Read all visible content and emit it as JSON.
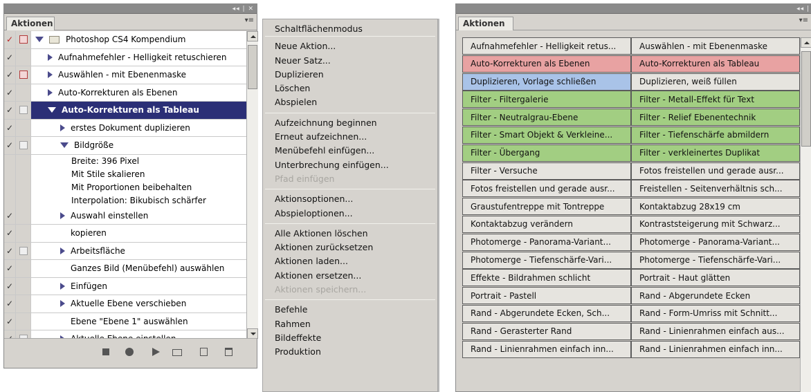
{
  "left_panel": {
    "window_controls": "◂◂ | ✕",
    "tab_label": "Aktionen",
    "menu_icon": "panel-menu-icon",
    "set": {
      "label": "Photoshop CS4 Kompendium",
      "check": "✓",
      "dialog_toggle": "red"
    },
    "actions": [
      {
        "label": "Aufnahmefehler - Helligkeit retuschieren",
        "check": "✓",
        "dialog": "none",
        "expanded": false
      },
      {
        "label": "Auswählen - mit Ebenenmaske",
        "check": "✓",
        "dialog": "red",
        "expanded": false
      },
      {
        "label": "Auto-Korrekturen als Ebenen",
        "check": "✓",
        "dialog": "none",
        "expanded": false
      },
      {
        "label": "Auto-Korrekturen als Tableau",
        "check": "✓",
        "dialog": "blank",
        "expanded": true,
        "selected": true
      }
    ],
    "steps": [
      {
        "label": "erstes Dokument duplizieren",
        "check": "✓",
        "dialog": "none",
        "expander": "right"
      },
      {
        "label": "Bildgröße",
        "check": "✓",
        "dialog": "blank",
        "expander": "down"
      }
    ],
    "step_details": [
      "Breite: 396 Pixel",
      "Mit Stile skalieren",
      "Mit Proportionen beibehalten",
      "Interpolation: Bikubisch schärfer"
    ],
    "steps_after": [
      {
        "label": "Auswahl einstellen",
        "check": "✓",
        "dialog": "none",
        "expander": "right"
      },
      {
        "label": "kopieren",
        "check": "✓",
        "dialog": "none",
        "expander": "none"
      },
      {
        "label": "Arbeitsfläche",
        "check": "✓",
        "dialog": "blank",
        "expander": "right"
      },
      {
        "label": "Ganzes Bild (Menübefehl) auswählen",
        "check": "✓",
        "dialog": "none",
        "expander": "none"
      },
      {
        "label": "Einfügen",
        "check": "✓",
        "dialog": "none",
        "expander": "right"
      },
      {
        "label": "Aktuelle Ebene verschieben",
        "check": "✓",
        "dialog": "none",
        "expander": "right"
      },
      {
        "label": "Ebene \"Ebene 1\" auswählen",
        "check": "✓",
        "dialog": "none",
        "expander": "none"
      },
      {
        "label": "Aktuelle Ebene einstellen",
        "check": "✓",
        "dialog": "blank",
        "expander": "right"
      }
    ],
    "bottom_buttons": [
      "stop-icon",
      "record-icon",
      "play-icon",
      "new-set-icon",
      "new-action-icon",
      "trash-icon"
    ]
  },
  "context_menu": {
    "groups": [
      [
        {
          "label": "Schaltflächenmodus",
          "enabled": true
        }
      ],
      [
        {
          "label": "Neue Aktion...",
          "enabled": true
        },
        {
          "label": "Neuer Satz...",
          "enabled": true
        },
        {
          "label": "Duplizieren",
          "enabled": true
        },
        {
          "label": "Löschen",
          "enabled": true
        },
        {
          "label": "Abspielen",
          "enabled": true
        }
      ],
      [
        {
          "label": "Aufzeichnung beginnen",
          "enabled": true
        },
        {
          "label": "Erneut aufzeichnen...",
          "enabled": true
        },
        {
          "label": "Menübefehl einfügen...",
          "enabled": true
        },
        {
          "label": "Unterbrechung einfügen...",
          "enabled": true
        },
        {
          "label": "Pfad einfügen",
          "enabled": false
        }
      ],
      [
        {
          "label": "Aktionsoptionen...",
          "enabled": true
        },
        {
          "label": "Abspieloptionen...",
          "enabled": true
        }
      ],
      [
        {
          "label": "Alle Aktionen löschen",
          "enabled": true
        },
        {
          "label": "Aktionen zurücksetzen",
          "enabled": true
        },
        {
          "label": "Aktionen laden...",
          "enabled": true
        },
        {
          "label": "Aktionen ersetzen...",
          "enabled": true
        },
        {
          "label": "Aktionen speichern...",
          "enabled": false
        }
      ],
      [
        {
          "label": "Befehle",
          "enabled": true
        },
        {
          "label": "Rahmen",
          "enabled": true
        },
        {
          "label": "Bildeffekte",
          "enabled": true
        },
        {
          "label": "Produktion",
          "enabled": true
        }
      ]
    ]
  },
  "right_panel": {
    "window_controls": "◂◂ |",
    "tab_label": "Aktionen",
    "colors": {
      "red": "#e8a2a2",
      "blue": "#a9c3e8",
      "green": "#a2ce82",
      "gray": "#e6e4df"
    },
    "buttons": [
      [
        {
          "label": "Aufnahmefehler - Helligkeit retus...",
          "color": "gray"
        },
        {
          "label": "Auswählen - mit Ebenenmaske",
          "color": "gray"
        }
      ],
      [
        {
          "label": "Auto-Korrekturen als Ebenen",
          "color": "red"
        },
        {
          "label": "Auto-Korrekturen als Tableau",
          "color": "red"
        }
      ],
      [
        {
          "label": "Duplizieren, Vorlage schließen",
          "color": "blue"
        },
        {
          "label": "Duplizieren, weiß füllen",
          "color": "gray"
        }
      ],
      [
        {
          "label": "Filter - Filtergalerie",
          "color": "green"
        },
        {
          "label": "Filter - Metall-Effekt für Text",
          "color": "green"
        }
      ],
      [
        {
          "label": "Filter - Neutralgrau-Ebene",
          "color": "green"
        },
        {
          "label": "Filter - Relief Ebenentechnik",
          "color": "green"
        }
      ],
      [
        {
          "label": "Filter - Smart Objekt & Verkleine...",
          "color": "green"
        },
        {
          "label": "Filter - Tiefenschärfe abmildern",
          "color": "green"
        }
      ],
      [
        {
          "label": "Filter - Übergang",
          "color": "green"
        },
        {
          "label": "Filter - verkleinertes Duplikat",
          "color": "green"
        }
      ],
      [
        {
          "label": "Filter - Versuche",
          "color": "gray"
        },
        {
          "label": "Fotos freistellen und gerade ausr...",
          "color": "gray"
        }
      ],
      [
        {
          "label": "Fotos freistellen und gerade ausr...",
          "color": "gray"
        },
        {
          "label": "Freistellen - Seitenverhältnis sch...",
          "color": "gray"
        }
      ],
      [
        {
          "label": "Graustufentreppe mit Tontreppe",
          "color": "gray"
        },
        {
          "label": "Kontaktabzug 28x19 cm",
          "color": "gray"
        }
      ],
      [
        {
          "label": "Kontaktabzug verändern",
          "color": "gray"
        },
        {
          "label": "Kontraststeigerung mit Schwarz...",
          "color": "gray"
        }
      ],
      [
        {
          "label": "Photomerge - Panorama-Variant...",
          "color": "gray"
        },
        {
          "label": "Photomerge - Panorama-Variant...",
          "color": "gray"
        }
      ],
      [
        {
          "label": "Photomerge - Tiefenschärfe-Vari...",
          "color": "gray"
        },
        {
          "label": "Photomerge - Tiefenschärfe-Vari...",
          "color": "gray"
        }
      ],
      [
        {
          "label": "Effekte - Bildrahmen schlicht",
          "color": "gray"
        },
        {
          "label": "Portrait - Haut glätten",
          "color": "gray"
        }
      ],
      [
        {
          "label": "Portrait - Pastell",
          "color": "gray"
        },
        {
          "label": "Rand - Abgerundete Ecken",
          "color": "gray"
        }
      ],
      [
        {
          "label": "Rand - Abgerundete Ecken, Sch...",
          "color": "gray"
        },
        {
          "label": "Rand - Form-Umriss mit Schnitt...",
          "color": "gray"
        }
      ],
      [
        {
          "label": "Rand - Gerasterter Rand",
          "color": "gray"
        },
        {
          "label": "Rand - Linienrahmen einfach aus...",
          "color": "gray"
        }
      ],
      [
        {
          "label": "Rand - Linienrahmen einfach inn...",
          "color": "gray"
        },
        {
          "label": "Rand - Linienrahmen einfach inn...",
          "color": "gray"
        }
      ]
    ]
  }
}
